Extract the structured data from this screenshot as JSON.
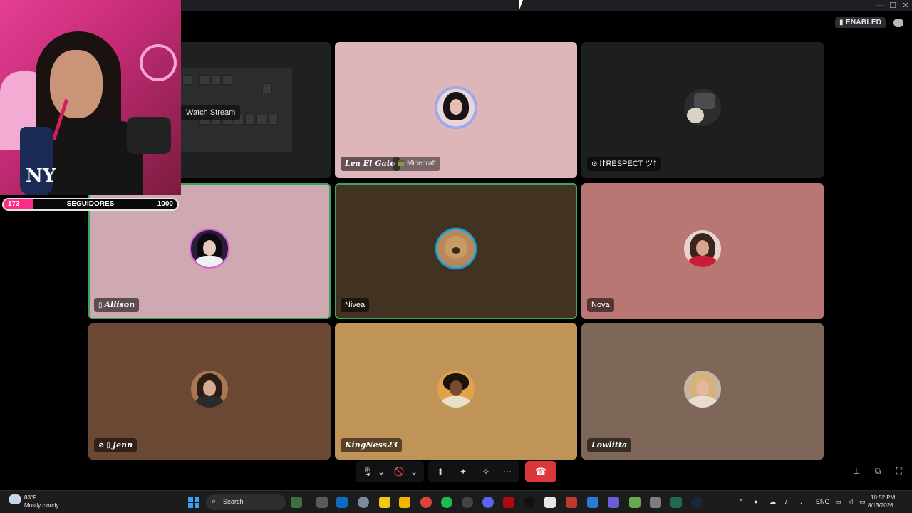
{
  "window": {
    "min_glyph": "—",
    "max_glyph": "☐",
    "close_glyph": "✕"
  },
  "status": {
    "enabled_label": "ENABLED"
  },
  "stream": {
    "watch_label": "Watch Stream"
  },
  "goal": {
    "current": "173",
    "label": "SEGUIDORES",
    "target": "1000",
    "progress_fraction": 0.173,
    "fill_color": "#ff2a8a"
  },
  "participants": [
    {
      "name": "Lea El Gato",
      "activity": "Minecraft",
      "bg": "#deb6ba",
      "speaking": false
    },
    {
      "name": "!☨RESPECT ツ☨",
      "bg": "#1c1e1f",
      "speaking": false
    },
    {
      "name": "Allison",
      "bg": "#cea9b2",
      "speaking": true
    },
    {
      "name": "Nivea",
      "bg": "#423221",
      "speaking": true
    },
    {
      "name": "Nova",
      "bg": "#b87773",
      "speaking": false
    },
    {
      "name": "Jenn",
      "bg": "#6a4834",
      "speaking": false
    },
    {
      "name": "KingNess23",
      "bg": "#c09358",
      "speaking": false
    },
    {
      "name": "Lowlitta",
      "bg": "#7e6658",
      "speaking": false
    }
  ],
  "controls": {
    "mic_glyph": "🎙",
    "caret_glyph": "⌄",
    "camera_glyph": "🚫",
    "screen_glyph": "⬆",
    "activity_glyph": "✦",
    "soundboard_glyph": "✧",
    "more_glyph": "⋯",
    "leave_glyph": "☎"
  },
  "taskbar": {
    "temperature": "83°F",
    "weather": "Mostly cloudy",
    "search_label": "Search",
    "language": "ENG",
    "time": "10:52 PM",
    "date": "8/13/2026"
  },
  "colors": {
    "speaking_ring": "#3ba55c",
    "leave_button": "#da373c",
    "taskbar": "#1c1c1c"
  }
}
